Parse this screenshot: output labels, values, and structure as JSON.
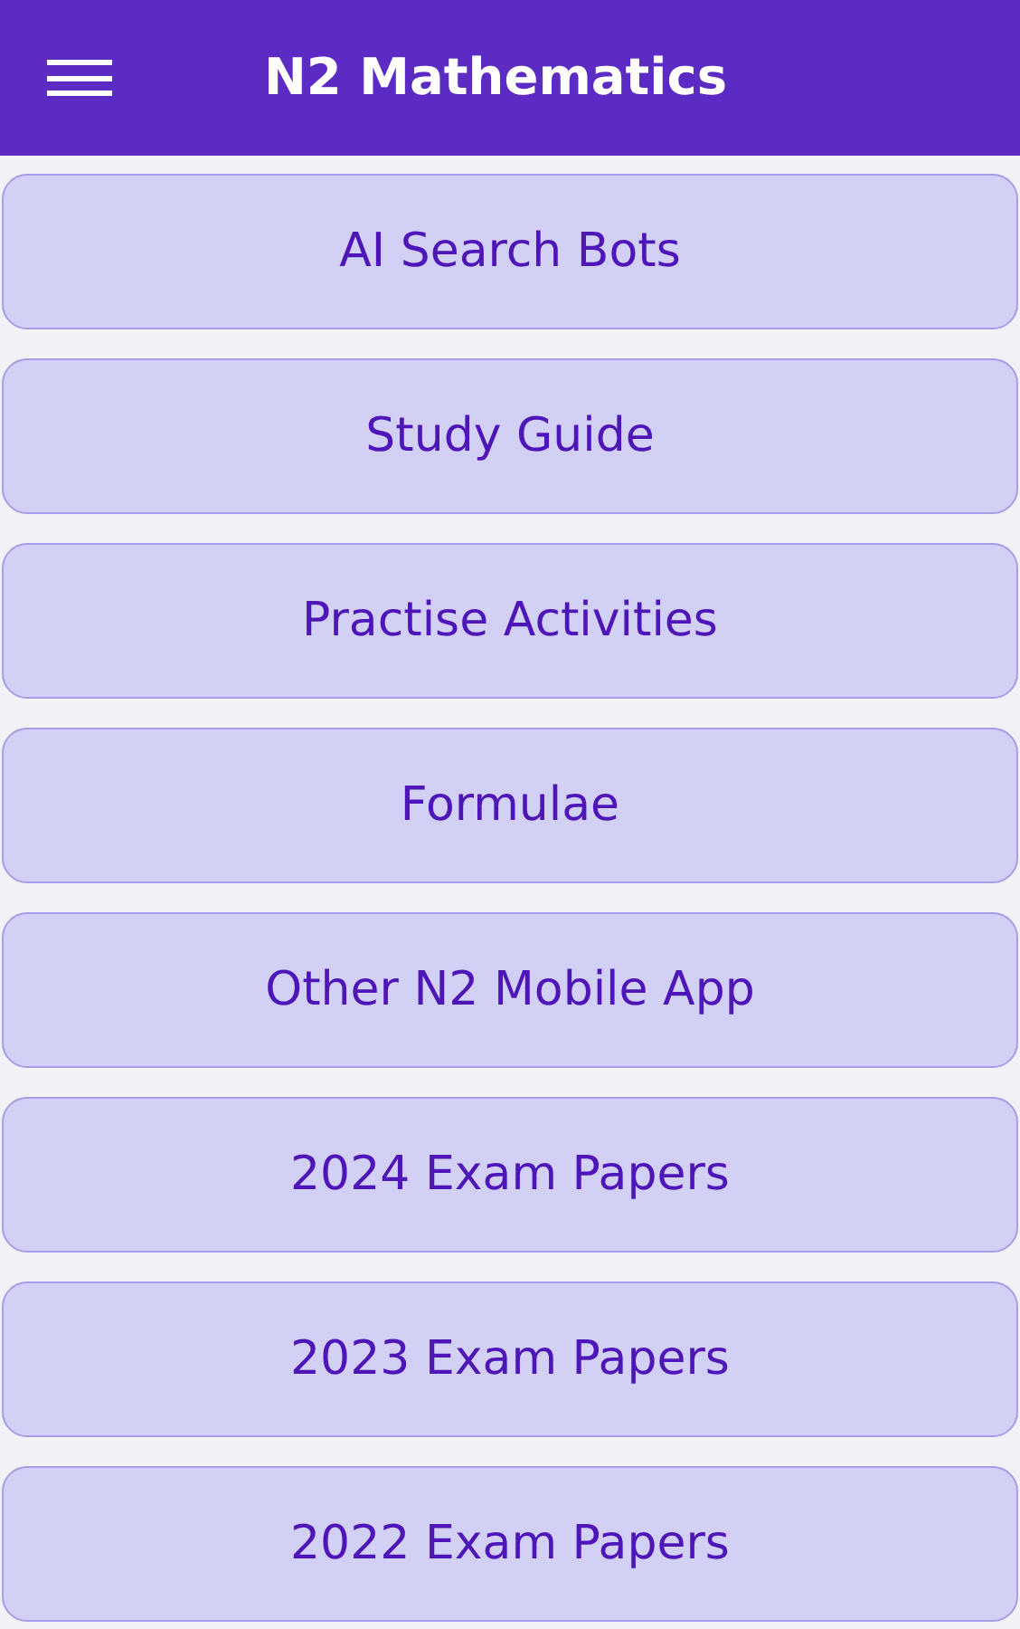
{
  "app_bar": {
    "title": "N2 Mathematics"
  },
  "menu_buttons": [
    {
      "label": "AI Search Bots"
    },
    {
      "label": "Study Guide"
    },
    {
      "label": "Practise Activities"
    },
    {
      "label": "Formulae"
    },
    {
      "label": "Other N2 Mobile App"
    },
    {
      "label": "2024 Exam Papers"
    },
    {
      "label": "2023 Exam Papers"
    },
    {
      "label": "2022 Exam Papers"
    }
  ]
}
